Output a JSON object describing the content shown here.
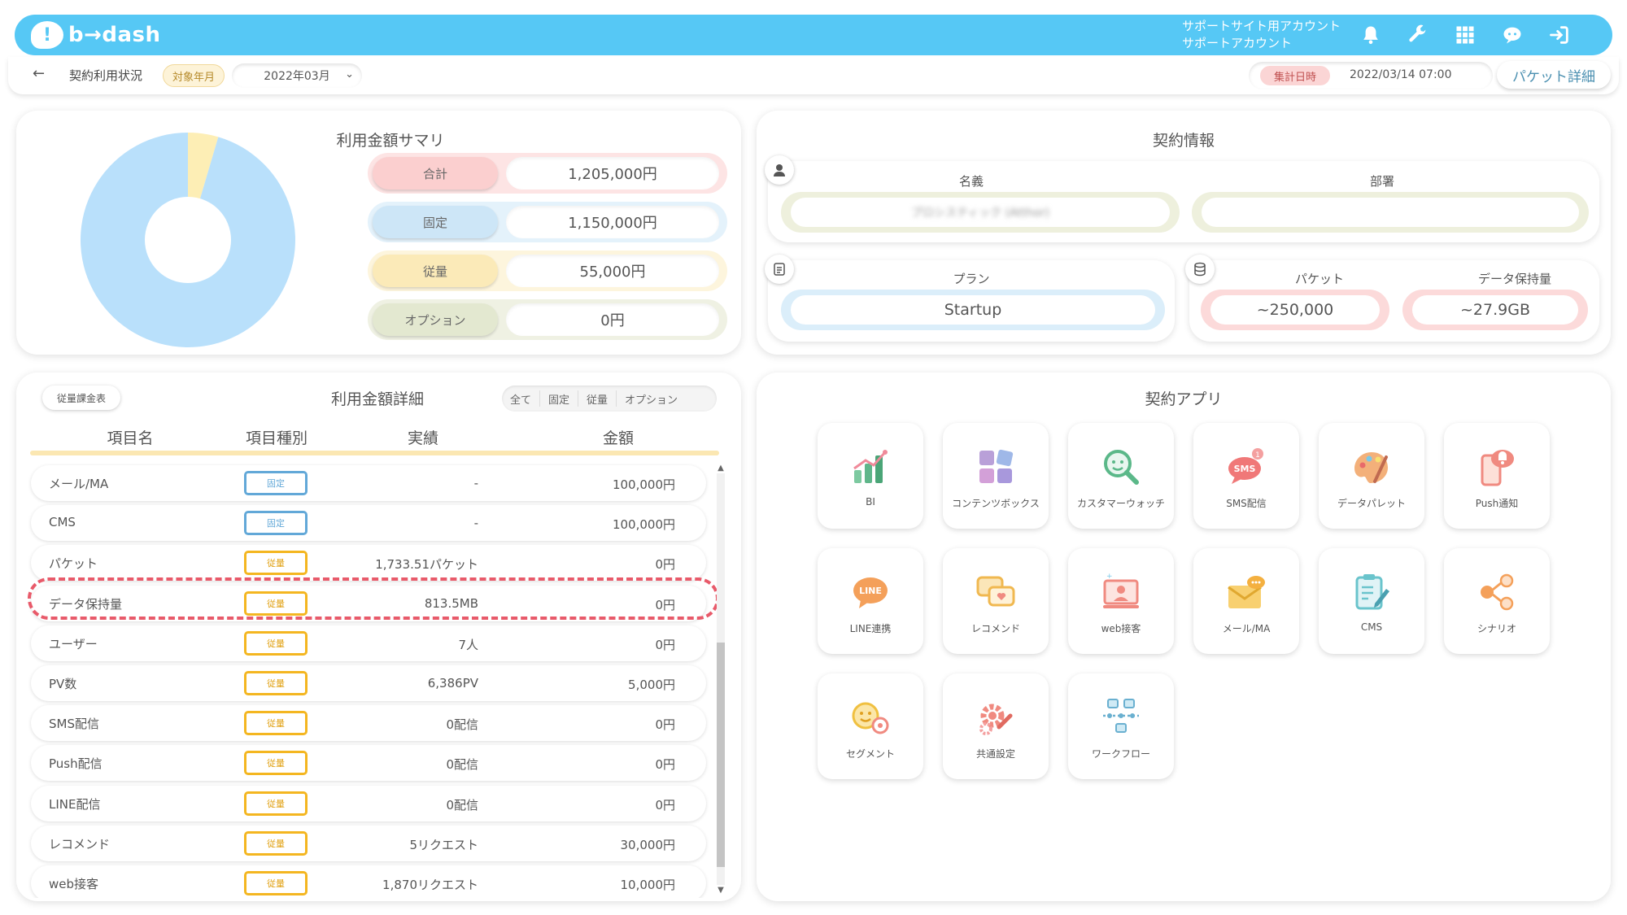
{
  "header": {
    "logo_mark": "!",
    "logo_text": "b→dash",
    "account_line1": "サポートサイト用アカウント",
    "account_line2": "サポートアカウント",
    "icons": [
      "bell-icon",
      "wrench-icon",
      "grid-icon",
      "support-chat-icon",
      "logout-icon"
    ]
  },
  "subbar": {
    "back_glyph": "←",
    "title": "契約利用状況",
    "target_label": "対象年月",
    "month": "2022年03月",
    "aggregate_label": "集計日時",
    "aggregate_value": "2022/03/14 07:00",
    "packet_button": "パケット詳細"
  },
  "summary": {
    "title": "利用金額サマリ",
    "rows": [
      {
        "label": "合計",
        "value": "1,205,000円"
      },
      {
        "label": "固定",
        "value": "1,150,000円"
      },
      {
        "label": "従量",
        "value": "55,000円"
      },
      {
        "label": "オプション",
        "value": "0円"
      }
    ],
    "donut": {
      "fixed_value": 1150000,
      "metered_value": 55000,
      "option_value": 0,
      "fixed_color": "#b9e0fb",
      "metered_color": "#fdeeb5"
    }
  },
  "contract": {
    "title": "契約情報",
    "name_label": "名義",
    "name_value": "プロシスティック (Atthor)",
    "dept_label": "部署",
    "dept_value": "",
    "plan_label": "プラン",
    "plan_value": "Startup",
    "packet_label": "パケット",
    "packet_value": "~250,000",
    "storage_label": "データ保持量",
    "storage_value": "~27.9GB"
  },
  "detail": {
    "title": "利用金額詳細",
    "rate_table_button": "従量課金表",
    "filters": [
      "全て",
      "固定",
      "従量",
      "オプション"
    ],
    "columns": [
      "項目名",
      "項目種別",
      "実績",
      "金額"
    ],
    "rows": [
      {
        "name": "メール/MA",
        "type": "固定",
        "kind": "fixed",
        "actual": "-",
        "amount": "100,000円"
      },
      {
        "name": "CMS",
        "type": "固定",
        "kind": "fixed",
        "actual": "-",
        "amount": "100,000円"
      },
      {
        "name": "パケット",
        "type": "従量",
        "kind": "var",
        "actual": "1,733.51パケット",
        "amount": "0円"
      },
      {
        "name": "データ保持量",
        "type": "従量",
        "kind": "var",
        "actual": "813.5MB",
        "amount": "0円"
      },
      {
        "name": "ユーザー",
        "type": "従量",
        "kind": "var",
        "actual": "7人",
        "amount": "0円"
      },
      {
        "name": "PV数",
        "type": "従量",
        "kind": "var",
        "actual": "6,386PV",
        "amount": "5,000円"
      },
      {
        "name": "SMS配信",
        "type": "従量",
        "kind": "var",
        "actual": "0配信",
        "amount": "0円"
      },
      {
        "name": "Push配信",
        "type": "従量",
        "kind": "var",
        "actual": "0配信",
        "amount": "0円"
      },
      {
        "name": "LINE配信",
        "type": "従量",
        "kind": "var",
        "actual": "0配信",
        "amount": "0円"
      },
      {
        "name": "レコメンド",
        "type": "従量",
        "kind": "var",
        "actual": "5リクエスト",
        "amount": "30,000円"
      },
      {
        "name": "web接客",
        "type": "従量",
        "kind": "var",
        "actual": "1,870リクエスト",
        "amount": "10,000円"
      }
    ]
  },
  "apps": {
    "title": "契約アプリ",
    "items": [
      {
        "label": "BI",
        "icon": "bi-chart-icon"
      },
      {
        "label": "コンテンツボックス",
        "icon": "content-box-icon"
      },
      {
        "label": "カスタマーウォッチ",
        "icon": "customer-watch-icon"
      },
      {
        "label": "SMS配信",
        "icon": "sms-icon"
      },
      {
        "label": "データパレット",
        "icon": "data-palette-icon"
      },
      {
        "label": "Push通知",
        "icon": "push-notification-icon"
      },
      {
        "label": "LINE連携",
        "icon": "line-icon"
      },
      {
        "label": "レコメンド",
        "icon": "recommend-icon"
      },
      {
        "label": "web接客",
        "icon": "web-service-icon"
      },
      {
        "label": "メール/MA",
        "icon": "mail-ma-icon"
      },
      {
        "label": "CMS",
        "icon": "cms-icon"
      },
      {
        "label": "シナリオ",
        "icon": "scenario-icon"
      },
      {
        "label": "セグメント",
        "icon": "segment-icon"
      },
      {
        "label": "共通設定",
        "icon": "common-settings-icon"
      },
      {
        "label": "ワークフロー",
        "icon": "workflow-icon"
      }
    ]
  },
  "colors": {
    "brand": "#56c8f5",
    "fixed_badge": "#62a8d8",
    "metered_badge": "#f4b620",
    "highlight": "#e85a6a"
  }
}
